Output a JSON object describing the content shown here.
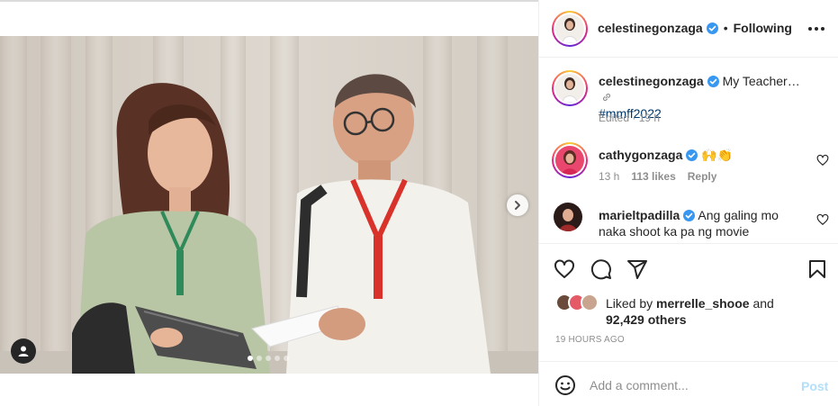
{
  "post": {
    "author": "celestinegonzaga",
    "follow_separator": "•",
    "follow_status": "Following",
    "caption_user": "celestinegonzaga",
    "caption_text": "My Teacher…",
    "caption_hashtag": "#mmff2022",
    "caption_meta": "Edited · 19 h",
    "likes_prefix": "Liked by",
    "likes_user": "merrelle_shooe",
    "likes_and": "and",
    "likes_others": "92,429 others",
    "posted_ago": "19 HOURS AGO"
  },
  "comments": [
    {
      "user": "cathygonzaga",
      "text": "🙌👏",
      "time": "13 h",
      "likes": "113 likes",
      "reply_label": "Reply"
    },
    {
      "user": "marieltpadilla",
      "text": "Ang galing mo naka shoot ka pa ng movie"
    }
  ],
  "composer": {
    "placeholder": "Add a comment...",
    "post_label": "Post"
  },
  "carousel": {
    "slide_count": 5,
    "active_slide": 1
  },
  "icons": {
    "verified": "verified-badge-icon",
    "more": "more-options-icon",
    "like": "heart-icon",
    "comment": "comment-icon",
    "share": "share-icon",
    "save": "bookmark-icon",
    "emoji": "emoji-icon",
    "next": "chevron-right-icon",
    "tag": "user-tag-icon",
    "link": "link-icon"
  },
  "colors": {
    "verified_blue": "#3897f0",
    "link_blue": "#00376b",
    "post_disabled": "#b2dffc",
    "muted": "#8e8e8e"
  }
}
